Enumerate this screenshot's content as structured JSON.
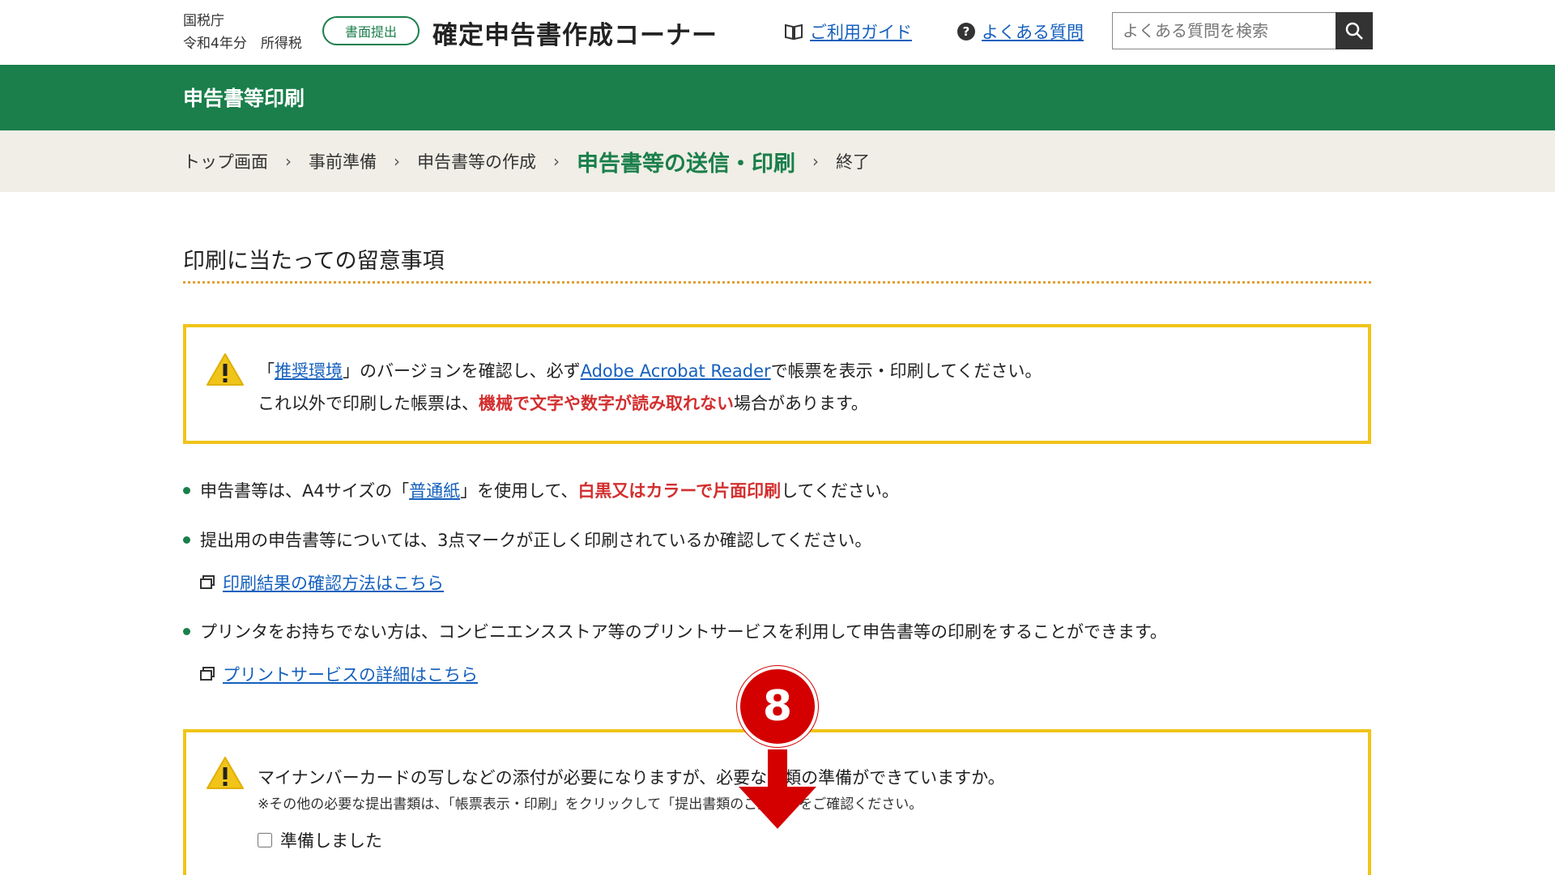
{
  "header": {
    "agency": "国税庁",
    "year_tax": "令和4年分　所得税",
    "mode_pill": "書面提出",
    "site_title": "確定申告書作成コーナー",
    "guide_link": "ご利用ガイド",
    "faq_link": "よくある質問",
    "search_placeholder": "よくある質問を検索"
  },
  "page_title": "申告書等印刷",
  "breadcrumb": {
    "items": [
      "トップ画面",
      "事前準備",
      "申告書等の作成",
      "申告書等の送信・印刷",
      "終了"
    ],
    "active_index": 3
  },
  "section_heading": "印刷に当たっての留意事項",
  "notice1": {
    "line1_pre": "「",
    "line1_link1": "推奨環境",
    "line1_mid": "」のバージョンを確認し、必ず",
    "line1_link2": "Adobe Acrobat Reader",
    "line1_post": "で帳票を表示・印刷してください。",
    "line2_pre": "これ以外で印刷した帳票は、",
    "line2_red": "機械で文字や数字が読み取れない",
    "line2_post": "場合があります。"
  },
  "bullets": [
    {
      "pre": "申告書等は、A4サイズの「",
      "link": "普通紙",
      "mid": "」を使用して、",
      "red": "白黒又はカラーで片面印刷",
      "post": "してください。"
    },
    {
      "text": "提出用の申告書等については、3点マークが正しく印刷されているか確認してください。",
      "sublink": "印刷結果の確認方法はこちら"
    },
    {
      "text": "プリンタをお持ちでない方は、コンビニエンスストア等のプリントサービスを利用して申告書等の印刷をすることができます。",
      "sublink": "プリントサービスの詳細はこちら"
    }
  ],
  "notice2": {
    "line1": "マイナンバーカードの写しなどの添付が必要になりますが、必要な書類の準備ができていますか。",
    "line2": "※その他の必要な提出書類は、「帳票表示・印刷」をクリックして「提出書類のご案内」をご確認ください。",
    "checkbox_label": "準備しました",
    "checkbox_checked": false
  },
  "annotation": {
    "number": "8"
  },
  "colors": {
    "green": "#1a7f4b",
    "link": "#1560bd",
    "warning_border": "#f0c419",
    "alert_red": "#d32f2f",
    "badge_red": "#d40000"
  }
}
